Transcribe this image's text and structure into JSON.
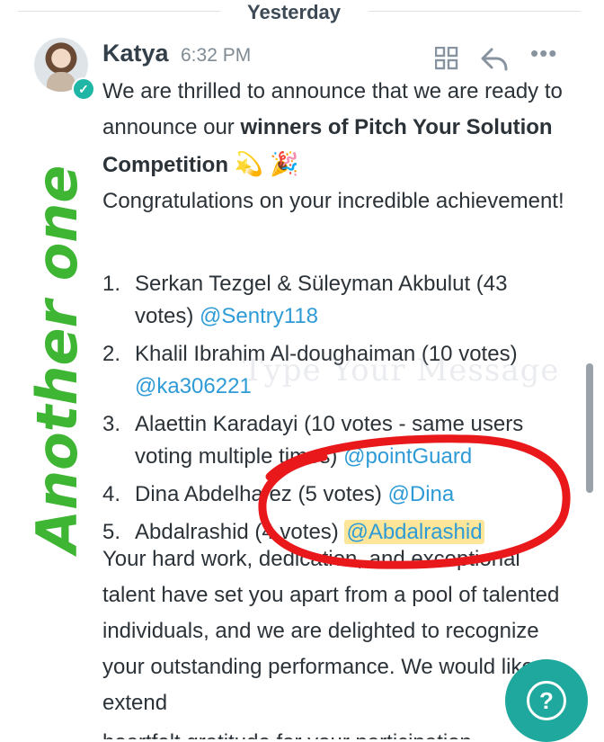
{
  "divider": {
    "label": "Yesterday"
  },
  "message": {
    "author": "Katya",
    "time": "6:32 PM",
    "intro_1": "We are thrilled to announce that we are ready to announce our ",
    "intro_bold": "winners of Pitch Your Solution Competition",
    "intro_emojis": "💫 🎉",
    "intro_2": "Congratulations on your incredible achievement!",
    "winners": [
      {
        "num": "1.",
        "text": "Serkan Tezgel & Süleyman Akbulut (43 votes) ",
        "mention": "@Sentry118"
      },
      {
        "num": "2.",
        "text": "Khalil Ibrahim Al-doughaiman (10 votes) ",
        "mention": "@ka306221"
      },
      {
        "num": "3.",
        "text": "Alaettin Karadayi (10 votes - same users voting multiple times) ",
        "mention": "@pointGuard"
      },
      {
        "num": "4.",
        "text": "Dina Abdelhafez (5 votes) ",
        "mention": "@Dina"
      },
      {
        "num": "5.",
        "text": "Abdalrashid (4 votes) ",
        "mention": "@Abdalrashid"
      }
    ],
    "outro": "Your hard work, dedication, and exceptional talent have set you apart from a pool of talented individuals, and we are delighted to recognize your outstanding performance. We would like to extend",
    "cut_line": "heartfelt gratitude for your participation"
  },
  "overlay": {
    "handwriting": "Another one",
    "watermark": "Type Your Message",
    "circle_color": "#e8181b",
    "handwriting_color": "#3fb534"
  },
  "icons": {
    "grid": "grid-icon",
    "reply": "reply-icon",
    "more": "more-icon",
    "help": "help-icon",
    "help_glyph": "?",
    "verified_glyph": "✓",
    "more_glyph": "•••"
  }
}
